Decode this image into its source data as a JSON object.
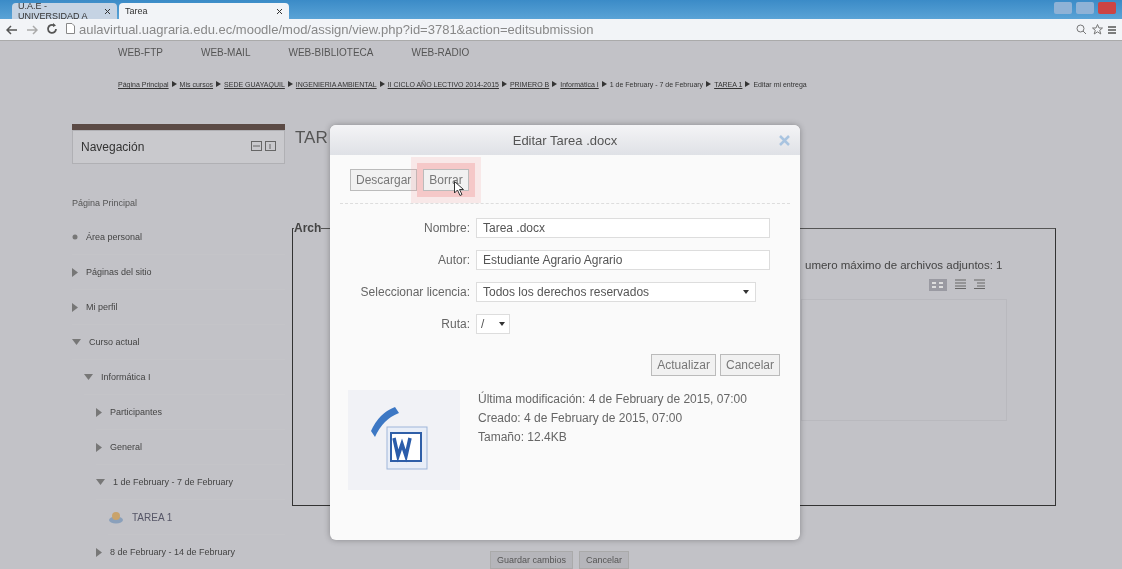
{
  "browser": {
    "tabs": [
      {
        "label": "U.A.E - UNIVERSIDAD A",
        "selected": false
      },
      {
        "label": "Tarea",
        "selected": true
      }
    ],
    "url_host": "aulavirtual.uagraria.edu.ec",
    "url_path": "/moodle/mod/assign/view.php?id=3781&action=editsubmission"
  },
  "top_links": [
    "WEB-FTP",
    "WEB-MAIL",
    "WEB-BIBLIOTECA",
    "WEB-RADIO"
  ],
  "breadcrumb": [
    {
      "label": "Página Principal",
      "kind": "link"
    },
    {
      "label": "Mis cursos",
      "kind": "link"
    },
    {
      "label": "SEDE GUAYAQUIL",
      "kind": "link"
    },
    {
      "label": "INGENIERIA AMBIENTAL",
      "kind": "link"
    },
    {
      "label": "II CICLO AÑO LECTIVO 2014-2015",
      "kind": "link"
    },
    {
      "label": "PRIMERO B",
      "kind": "link"
    },
    {
      "label": "Informática I",
      "kind": "link"
    },
    {
      "label": "1 de February - 7 de February",
      "kind": "text"
    },
    {
      "label": "TAREA 1",
      "kind": "link"
    },
    {
      "label": "Editar mi entrega",
      "kind": "text"
    }
  ],
  "navigation": {
    "title": "Navegación",
    "home": "Página Principal",
    "items": [
      {
        "label": "Área personal",
        "kind": "leaf"
      },
      {
        "label": "Páginas del sitio",
        "kind": "branch",
        "expanded": false
      },
      {
        "label": "Mi perfil",
        "kind": "branch",
        "expanded": false
      },
      {
        "label": "Curso actual",
        "kind": "branch",
        "expanded": true,
        "children": [
          {
            "label": "Informática I",
            "kind": "branch",
            "expanded": true,
            "children": [
              {
                "label": "Participantes",
                "kind": "branch",
                "expanded": false
              },
              {
                "label": "General",
                "kind": "branch",
                "expanded": false
              },
              {
                "label": "1 de February - 7 de February",
                "kind": "branch",
                "expanded": true,
                "children": [
                  {
                    "label": "TAREA 1",
                    "kind": "activity"
                  }
                ]
              },
              {
                "label": "8 de February - 14 de February",
                "kind": "branch",
                "expanded": false
              }
            ]
          }
        ]
      }
    ]
  },
  "main": {
    "heading": "TAR",
    "legend": "Arch",
    "max_files": "umero máximo de archivos adjuntos: 1"
  },
  "dialog": {
    "title": "Editar Tarea .docx",
    "actions": [
      {
        "label": "Descargar",
        "highlighted": false
      },
      {
        "label": "Borrar",
        "highlighted": true
      }
    ],
    "fields": [
      {
        "label": "Nombre:",
        "kind": "text",
        "value": "Tarea .docx"
      },
      {
        "label": "Autor:",
        "kind": "text",
        "value": "Estudiante Agrario Agrario"
      },
      {
        "label": "Seleccionar licencia:",
        "kind": "select",
        "value": "Todos los derechos reservados"
      },
      {
        "label": "Ruta:",
        "kind": "small-select",
        "value": "/"
      }
    ],
    "buttons": [
      "Actualizar",
      "Cancelar"
    ],
    "info": [
      "Última modificación: 4 de February de 2015, 07:00",
      "Creado: 4 de February de 2015, 07:00",
      "Tamaño: 12.4KB"
    ]
  },
  "footer_buttons": [
    "Guardar cambios",
    "Cancelar"
  ]
}
